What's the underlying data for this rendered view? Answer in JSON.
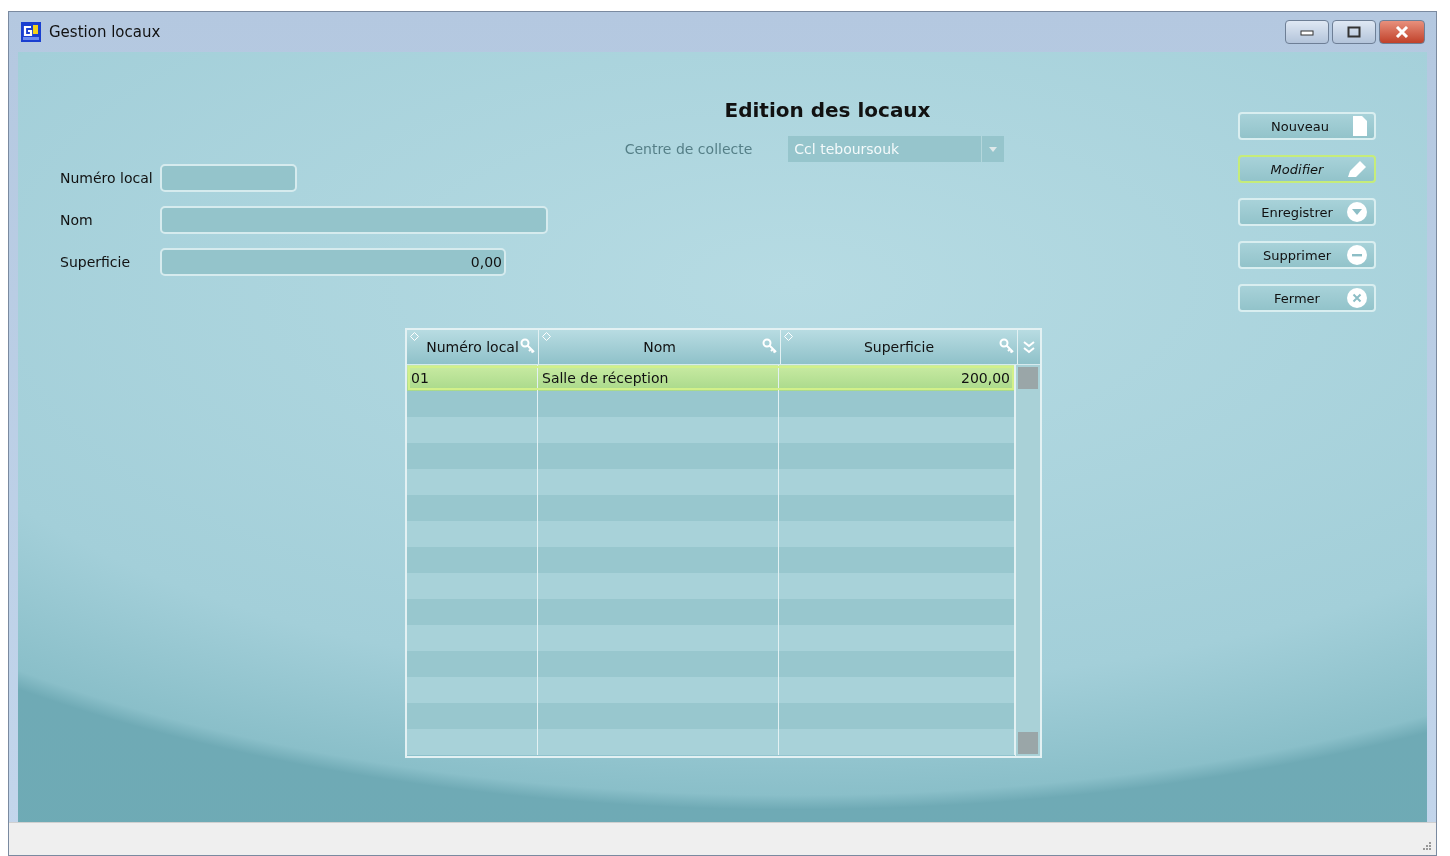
{
  "window": {
    "title": "Gestion locaux"
  },
  "heading": "Edition des locaux",
  "centre": {
    "label": "Centre de collecte",
    "value": "Ccl teboursouk",
    "disabled": true
  },
  "fields": [
    {
      "label": "Numéro local"
    },
    {
      "label": "Nom"
    },
    {
      "label": "Superficie",
      "value": "0,00"
    }
  ],
  "buttons": [
    {
      "label": "Nouveau",
      "kind": "new",
      "focused": false
    },
    {
      "label": "Modifier",
      "kind": "edit",
      "focused": true
    },
    {
      "label": "Enregistrer",
      "kind": "save",
      "focused": false
    },
    {
      "label": "Supprimer",
      "kind": "delete",
      "focused": false
    },
    {
      "label": "Fermer",
      "kind": "close",
      "focused": false
    }
  ],
  "table": {
    "columns": [
      "Numéro local",
      "Nom",
      "Superficie"
    ],
    "rows": [
      {
        "cells": [
          "01",
          "Salle de réception",
          "200,00"
        ],
        "selected": true
      }
    ]
  }
}
